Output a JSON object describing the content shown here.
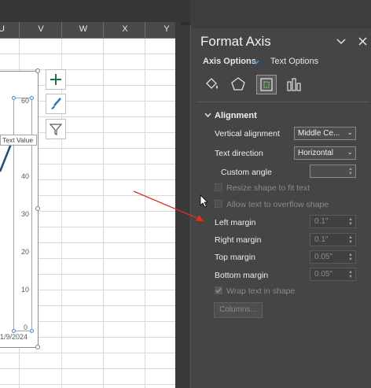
{
  "sheet": {
    "columns": [
      "U",
      "V",
      "W",
      "X",
      "Y"
    ]
  },
  "chart": {
    "title_box": "Text Value",
    "axis_ticks": [
      "60",
      "40",
      "30",
      "20",
      "10",
      "0"
    ],
    "date_label": "1/9/2024",
    "tools": [
      "chart-elements",
      "chart-styles",
      "chart-filters"
    ]
  },
  "pane": {
    "title": "Format Axis",
    "tabs": {
      "axis_options": "Axis Options",
      "text_options": "Text Options"
    },
    "section": "Alignment",
    "rows": {
      "vertical_alignment": {
        "label": "Vertical alignment",
        "value": "Middle Ce..."
      },
      "text_direction": {
        "label": "Text direction",
        "value": "Horizontal"
      },
      "custom_angle": {
        "label": "Custom angle",
        "value": ""
      },
      "resize_shape": "Resize shape to fit text",
      "allow_overflow": "Allow text to overflow shape",
      "left_margin": {
        "label": "Left margin",
        "value": "0.1\""
      },
      "right_margin": {
        "label": "Right margin",
        "value": "0.1\""
      },
      "top_margin": {
        "label": "Top margin",
        "value": "0.05\""
      },
      "bottom_margin": {
        "label": "Bottom margin",
        "value": "0.05\""
      },
      "wrap_text": "Wrap text in shape",
      "columns_button": "Columns..."
    }
  },
  "colors": {
    "accent": "#4f81bd",
    "annotation_arrow": "#d93025",
    "pane_bg": "#454545"
  }
}
